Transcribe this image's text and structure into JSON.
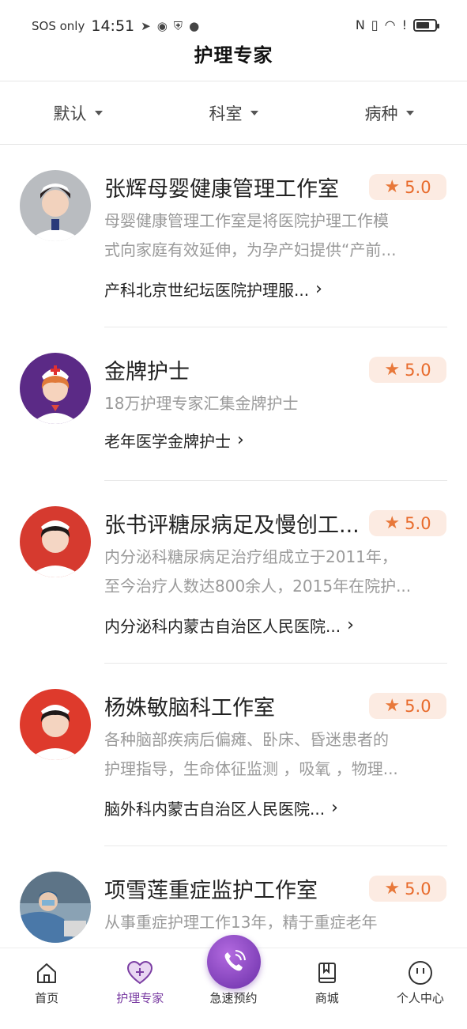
{
  "status_bar": {
    "carrier": "SOS only",
    "time": "14:51"
  },
  "header": {
    "title": "护理专家"
  },
  "filters": [
    {
      "label": "默认"
    },
    {
      "label": "科室"
    },
    {
      "label": "病种"
    }
  ],
  "experts": [
    {
      "name": "张辉母婴健康管理工作室",
      "rating": "5.0",
      "desc_line1": "母婴健康管理工作室是将医院护理工作模",
      "desc_line2": "式向家庭有效延伸，为孕产妇提供“产前...",
      "dept": "产科北京世纪坛医院护理服...",
      "avatar_bg": "#b9bcc0"
    },
    {
      "name": "金牌护士",
      "rating": "5.0",
      "desc_line1": "18万护理专家汇集金牌护士",
      "desc_line2": "",
      "dept": "老年医学金牌护士",
      "avatar_bg": "#5b2a86"
    },
    {
      "name": "张书评糖尿病足及慢创工...",
      "rating": "5.0",
      "desc_line1": "内分泌科糖尿病足治疗组成立于2011年，",
      "desc_line2": "至今治疗人数达800余人，2015年在院护...",
      "dept": "内分泌科内蒙古自治区人民医院...",
      "avatar_bg": "#d63a2f"
    },
    {
      "name": "杨姝敏脑科工作室",
      "rating": "5.0",
      "desc_line1": "各种脑部疾病后偏瘫、卧床、昏迷患者的",
      "desc_line2": "护理指导，生命体征监测 ，吸氧 ，物理...",
      "dept": "脑外科内蒙古自治区人民医院...",
      "avatar_bg": "#de3a2c"
    },
    {
      "name": "项雪莲重症监护工作室",
      "rating": "5.0",
      "desc_line1": "从事重症护理工作13年，精于重症老年",
      "desc_line2": "",
      "dept": "",
      "avatar_bg": "#6f8fa8"
    }
  ],
  "tabs": [
    {
      "label": "首页"
    },
    {
      "label": "护理专家"
    },
    {
      "label": "急速预约"
    },
    {
      "label": "商城"
    },
    {
      "label": "个人中心"
    }
  ],
  "colors": {
    "accent": "#7b3ea3",
    "rating_bg": "#fcebe2",
    "rating_text": "#e86b2c"
  }
}
